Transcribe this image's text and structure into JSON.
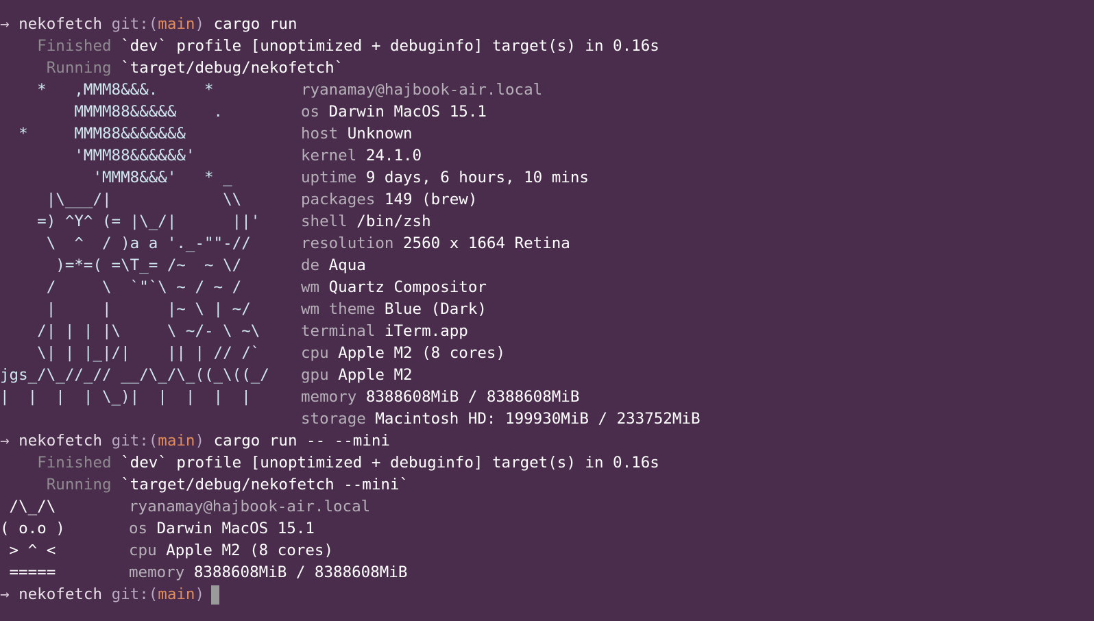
{
  "session1": {
    "prompt": {
      "arrow": "→",
      "dir": "nekofetch",
      "git_label": "git:(",
      "branch": "main",
      "git_close": ")",
      "command": "cargo run"
    },
    "finished": {
      "word": "Finished",
      "rest": "`dev` profile [unoptimized + debuginfo] target(s) in 0.16s"
    },
    "running": {
      "word": "Running",
      "rest": "`target/debug/nekofetch`"
    },
    "ascii": [
      "    *   ,MMM8&&&.     *",
      "        MMMM88&&&&&    .",
      "  *     MMM88&&&&&&&",
      "        'MMM88&&&&&&'",
      "          'MMM8&&&'   * _",
      "     |\\___/|            \\\\",
      "    =) ^Y^ (= |\\_/|      ||'",
      "     \\  ^  / )a a '._-\"\"-//",
      "      )=*=( =\\T_= /~  ~ \\/",
      "     /     \\  `\"`\\ ~ / ~ /",
      "     |     |      |~ \\ | ~/",
      "    /| | | |\\     \\ ~/- \\ ~\\",
      "    \\| | |_|/|    || | // /`",
      "jgs_/\\_//_// __/\\_/\\_((_\\((_/",
      "|  |  |  | \\_)|  |  |  |  |",
      ""
    ],
    "info": [
      {
        "key": "",
        "value": "ryanamay@hajbook-air.local"
      },
      {
        "key": "os",
        "value": "Darwin MacOS 15.1"
      },
      {
        "key": "host",
        "value": "Unknown"
      },
      {
        "key": "kernel",
        "value": "24.1.0"
      },
      {
        "key": "uptime",
        "value": "9 days, 6 hours, 10 mins"
      },
      {
        "key": "packages",
        "value": "149 (brew)"
      },
      {
        "key": "shell",
        "value": "/bin/zsh"
      },
      {
        "key": "resolution",
        "value": "2560 x 1664 Retina"
      },
      {
        "key": "de",
        "value": "Aqua"
      },
      {
        "key": "wm",
        "value": "Quartz Compositor"
      },
      {
        "key": "wm theme",
        "value": "Blue (Dark)"
      },
      {
        "key": "terminal",
        "value": "iTerm.app"
      },
      {
        "key": "cpu",
        "value": "Apple M2 (8 cores)"
      },
      {
        "key": "gpu",
        "value": "Apple M2"
      },
      {
        "key": "memory",
        "value": "8388608MiB / 8388608MiB"
      },
      {
        "key": "storage",
        "value": "Macintosh HD: 199930MiB / 233752MiB"
      }
    ]
  },
  "session2": {
    "prompt": {
      "arrow": "→",
      "dir": "nekofetch",
      "git_label": "git:(",
      "branch": "main",
      "git_close": ")",
      "command": "cargo run -- --mini"
    },
    "finished": {
      "word": "Finished",
      "rest": "`dev` profile [unoptimized + debuginfo] target(s) in 0.16s"
    },
    "running": {
      "word": "Running",
      "rest": "`target/debug/nekofetch --mini`"
    },
    "ascii": [
      " /\\_/\\",
      "( o.o )",
      " > ^ <",
      " ====="
    ],
    "info": [
      {
        "key": "",
        "value": "ryanamay@hajbook-air.local"
      },
      {
        "key": "os",
        "value": "Darwin MacOS 15.1"
      },
      {
        "key": "cpu",
        "value": "Apple M2 (8 cores)"
      },
      {
        "key": "memory",
        "value": "8388608MiB / 8388608MiB"
      }
    ]
  },
  "final_prompt": {
    "arrow": "→",
    "dir": "nekofetch",
    "git_label": "git:(",
    "branch": "main",
    "git_close": ")"
  },
  "colors": {
    "background": "#4a2d4c",
    "branch": "#e08b5b",
    "ascii_art": "#cfe7ee",
    "key": "#b6b0b8",
    "dim": "#8f8a90"
  }
}
